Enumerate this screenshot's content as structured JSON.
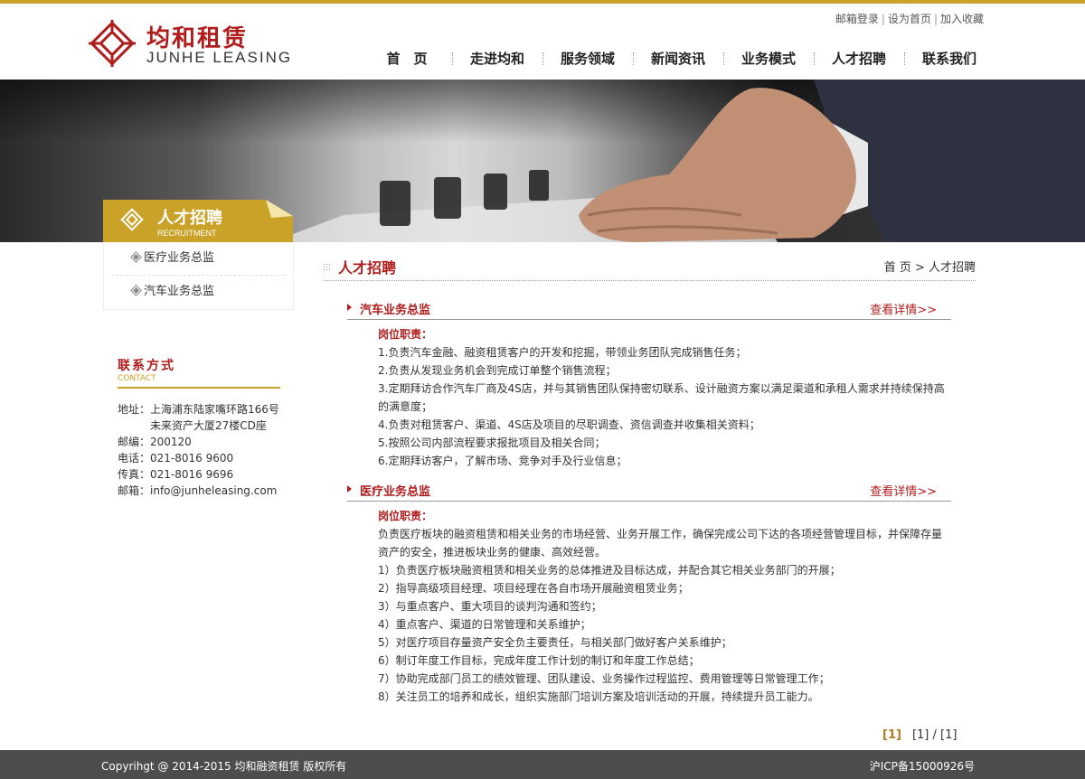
{
  "brand": {
    "name_cn": "均和租赁",
    "name_en": "JUNHE LEASING",
    "accent_color": "#c9a227",
    "brand_color": "#b01c1c",
    "logo_icon": "lattice-diamond-logo"
  },
  "top_links": [
    {
      "label": "邮箱登录"
    },
    {
      "label": "设为首页"
    },
    {
      "label": "加入收藏"
    }
  ],
  "nav": {
    "items": [
      {
        "label": "首　页"
      },
      {
        "label": "走进均和"
      },
      {
        "label": "服务领域"
      },
      {
        "label": "新闻资讯"
      },
      {
        "label": "业务模式"
      },
      {
        "label": "人才招聘"
      },
      {
        "label": "联系我们"
      }
    ]
  },
  "section_tab": {
    "title": "人才招聘",
    "subtitle": "RECRUITMENT"
  },
  "sidebar": {
    "items": [
      {
        "label": "医疗业务总监"
      },
      {
        "label": "汽车业务总监"
      }
    ]
  },
  "contact": {
    "title": "联系方式",
    "subtitle": "CONTACT",
    "address_label": "地址：",
    "address_line1": "上海浦东陆家嘴环路166号",
    "address_line2": "未来资产大厦27楼CD座",
    "postcode": "邮编：200120",
    "phone": "电话：021-8016 9600",
    "fax": "传真：021-8016 9696",
    "email": "邮箱：info@junheleasing.com"
  },
  "main": {
    "title": "人才招聘",
    "breadcrumb": "首 页 > 人才招聘",
    "jobs": [
      {
        "title": "汽车业务总监",
        "more": "查看详情>>",
        "duty_label": "岗位职责：",
        "lines": [
          "1.负责汽车金融、融资租赁客户的开发和挖掘，带领业务团队完成销售任务；",
          "2.负责从发现业务机会到完成订单整个销售流程；",
          "3.定期拜访合作汽车厂商及4S店，并与其销售团队保持密切联系、设计融资方案以满足渠道和承租人需求并持续保持高的满意度；",
          "4.负责对租赁客户、渠道、4S店及项目的尽职调查、资信调查并收集相关资料；",
          "5.按照公司内部流程要求报批项目及相关合同；",
          "6.定期拜访客户，了解市场、竞争对手及行业信息；"
        ]
      },
      {
        "title": "医疗业务总监",
        "more": "查看详情>>",
        "duty_label": "岗位职责：",
        "lines": [
          "负责医疗板块的融资租赁和相关业务的市场经营、业务开展工作，确保完成公司下达的各项经营管理目标，并保障存量资产的安全，推进板块业务的健康、高效经营。",
          "1）负责医疗板块融资租赁和相关业务的总体推进及目标达成，并配合其它相关业务部门的开展；",
          "2）指导高级项目经理、项目经理在各自市场开展融资租赁业务；",
          "3）与重点客户、重大项目的谈判沟通和签约；",
          "4）重点客户、渠道的日常管理和关系维护；",
          "5）对医疗项目存量资产安全负主要责任，与相关部门做好客户关系维护；",
          "6）制订年度工作目标，完成年度工作计划的制订和年度工作总结；",
          "7）协助完成部门员工的绩效管理、团队建设、业务操作过程监控、费用管理等日常管理工作；",
          "8）关注员工的培养和成长，组织实施部门培训方案及培训活动的开展，持续提升员工能力。"
        ]
      }
    ]
  },
  "pager": {
    "current": "[1]",
    "status": "[1] / [1]"
  },
  "footer": {
    "copyright": "Copyrihgt @ 2014-2015 均和融资租赁 版权所有",
    "icp": "沪ICP备15000926号"
  }
}
